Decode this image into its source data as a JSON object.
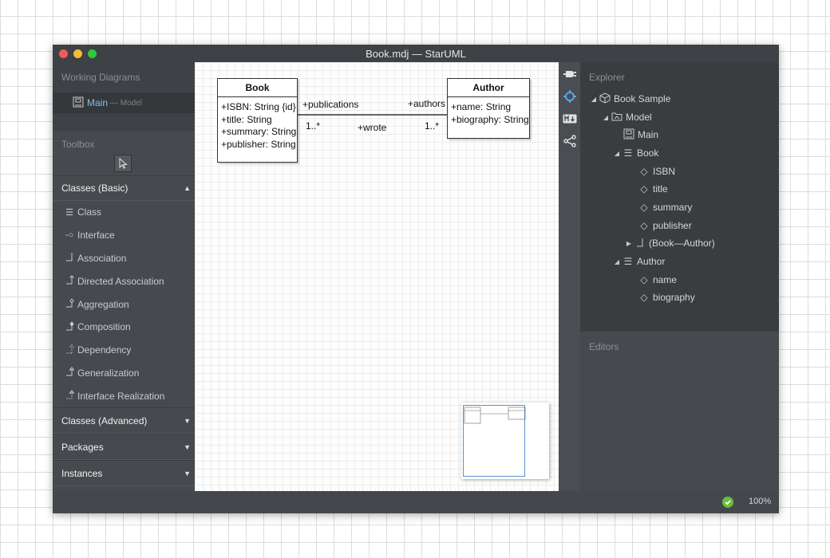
{
  "window": {
    "title": "Book.mdj — StarUML"
  },
  "working_diagrams": {
    "header": "Working Diagrams",
    "items": [
      {
        "name": "Main",
        "sub": "— Model"
      }
    ]
  },
  "toolbox": {
    "header": "Toolbox",
    "sections": [
      {
        "label": "Classes (Basic)",
        "expanded": true
      },
      {
        "label": "Classes (Advanced)",
        "expanded": false
      },
      {
        "label": "Packages",
        "expanded": false
      },
      {
        "label": "Instances",
        "expanded": false
      }
    ],
    "tools": [
      {
        "label": "Class",
        "icon": "class-icon"
      },
      {
        "label": "Interface",
        "icon": "interface-icon"
      },
      {
        "label": "Association",
        "icon": "association-icon"
      },
      {
        "label": "Directed Association",
        "icon": "directed-association-icon"
      },
      {
        "label": "Aggregation",
        "icon": "aggregation-icon"
      },
      {
        "label": "Composition",
        "icon": "composition-icon"
      },
      {
        "label": "Dependency",
        "icon": "dependency-icon"
      },
      {
        "label": "Generalization",
        "icon": "generalization-icon"
      },
      {
        "label": "Interface Realization",
        "icon": "interface-realization-icon"
      }
    ]
  },
  "diagram": {
    "book": {
      "name": "Book",
      "attributes": [
        "+ISBN: String {id}",
        "+title: String",
        "+summary: String",
        "+publisher: String"
      ]
    },
    "author": {
      "name": "Author",
      "attributes": [
        "+name: String",
        "+biography: String"
      ]
    },
    "association": {
      "book_end_role": "+publications",
      "book_end_mult": "1..*",
      "author_end_role": "+authors",
      "author_end_mult": "1..*",
      "name": "+wrote"
    }
  },
  "explorer": {
    "header": "Explorer",
    "tree": [
      {
        "label": "Book Sample",
        "icon": "project-icon",
        "expanded": true
      },
      {
        "label": "Model",
        "icon": "model-icon",
        "expanded": true
      },
      {
        "label": "Main",
        "icon": "diagram-icon"
      },
      {
        "label": "Book",
        "icon": "class-icon",
        "expanded": true
      },
      {
        "label": "ISBN",
        "icon": "attribute-icon"
      },
      {
        "label": "title",
        "icon": "attribute-icon"
      },
      {
        "label": "summary",
        "icon": "attribute-icon"
      },
      {
        "label": "publisher",
        "icon": "attribute-icon"
      },
      {
        "label": "(Book—Author)",
        "icon": "association-icon",
        "expanded": false
      },
      {
        "label": "Author",
        "icon": "class-icon",
        "expanded": true
      },
      {
        "label": "name",
        "icon": "attribute-icon"
      },
      {
        "label": "biography",
        "icon": "attribute-icon"
      }
    ]
  },
  "editors": {
    "header": "Editors"
  },
  "status": {
    "zoom": "100%"
  }
}
